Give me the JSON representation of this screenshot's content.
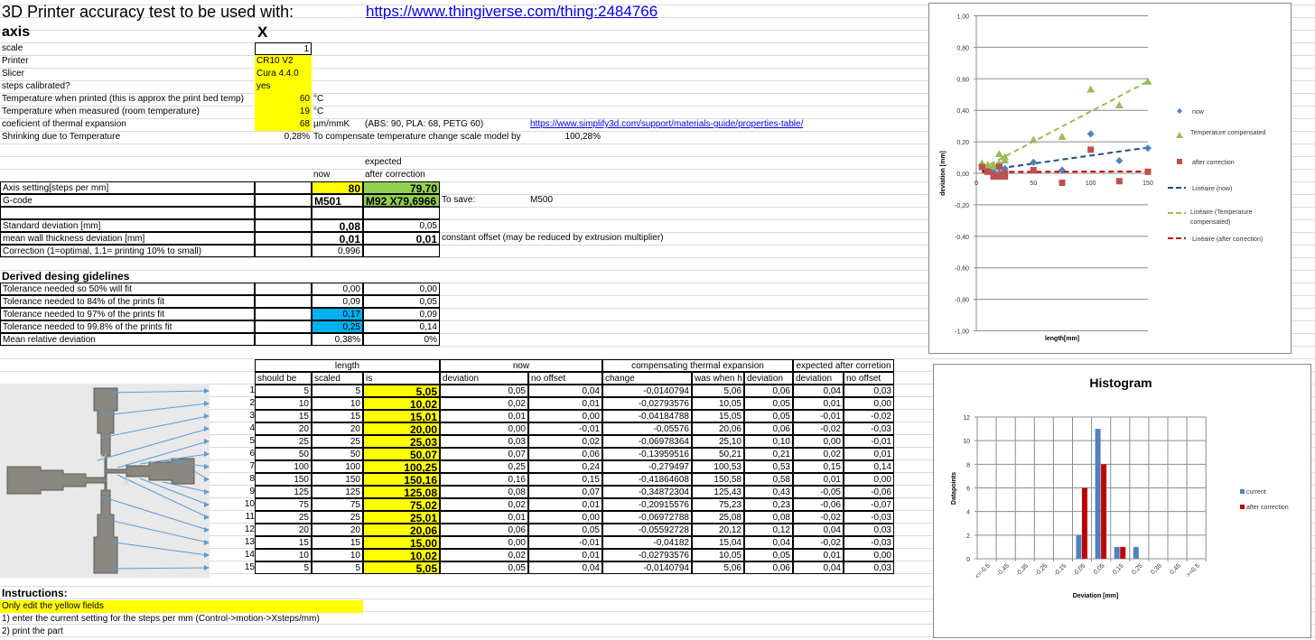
{
  "title": "3D Printer accuracy test to be used with:",
  "link": "https://www.thingiverse.com/thing:2484766",
  "axis": {
    "label": "axis",
    "value": "X"
  },
  "params": [
    {
      "label": "scale",
      "value": "1",
      "unit": ""
    },
    {
      "label": "Printer",
      "value": "CR10 V2",
      "unit": ""
    },
    {
      "label": "Slicer",
      "value": "Cura 4.4.0",
      "unit": ""
    },
    {
      "label": "steps calibrated?",
      "value": "yes",
      "unit": ""
    },
    {
      "label": "Temperature when printed (this is approx the print bed temp)",
      "value": "60",
      "unit": "°C"
    },
    {
      "label": "Temperature when measured (room temperature)",
      "value": "19",
      "unit": "°C"
    },
    {
      "label": "coeficient of thermal expansion",
      "value": "68",
      "unit": "µm/mmK"
    },
    {
      "label": "Shrinking due to Temperature",
      "value": "0,28%",
      "unit": ""
    }
  ],
  "thermal_note": "(ABS: 90, PLA: 68, PETG 60)",
  "thermal_link": "https://www.simplify3d.com/support/materials-guide/properties-table/",
  "compensate_label": "To compensate temperature change scale model by",
  "compensate_value": "100,28%",
  "headers": {
    "expected": "expected",
    "now": "now",
    "after": "after correction"
  },
  "axis_setting": {
    "label": "Axis setting[steps per mm]",
    "now": "80",
    "after": "79,70"
  },
  "gcode": {
    "label": "G-code",
    "now": "M501",
    "after": "M92 X79,6966",
    "save_label": "To save:",
    "save_value": "M500"
  },
  "std": {
    "label": "Standard deviation [mm]",
    "now": "0,08",
    "after": "0,05"
  },
  "mean_wall": {
    "label": "mean wall thickness deviation [mm]",
    "now": "0,01",
    "after": "0,01",
    "note": "constant offset (may be reduced by extrusion multiplier)"
  },
  "correction": {
    "label": "Correction (1=optimal, 1.1= printing 10% to small)",
    "now": "0,996"
  },
  "guidelines": {
    "title": "Derived desing gidelines",
    "rows": [
      {
        "label": "Tolerance needed so 50% will fit",
        "now": "0,00",
        "after": "0,00"
      },
      {
        "label": "Tolerance needed to 84% of the prints fit",
        "now": "0,09",
        "after": "0,05"
      },
      {
        "label": "Tolerance needed to 97% of the prints fit",
        "now": "0,17",
        "after": "0,09"
      },
      {
        "label": "Tolerance needed to 99.8% of the prints fit",
        "now": "0,25",
        "after": "0,14"
      },
      {
        "label": "Mean relative deviation",
        "now": "0,38%",
        "after": "0%"
      }
    ]
  },
  "table": {
    "groups": {
      "length": "length",
      "now": "now",
      "comp": "compensating thermal expansion",
      "expected": "expected after corretion"
    },
    "columns": [
      "should be",
      "scaled",
      "is",
      "deviation",
      "no offset",
      "change",
      "was when h",
      "deviation",
      "deviation",
      "no offset"
    ],
    "rows": [
      [
        "1",
        "5",
        "5",
        "5,05",
        "0,05",
        "0,04",
        "-0,0140794",
        "5,06",
        "0,06",
        "0,04",
        "0,03"
      ],
      [
        "2",
        "10",
        "10",
        "10,02",
        "0,02",
        "0,01",
        "-0,02793576",
        "10,05",
        "0,05",
        "0,01",
        "0,00"
      ],
      [
        "3",
        "15",
        "15",
        "15,01",
        "0,01",
        "0,00",
        "-0,04184788",
        "15,05",
        "0,05",
        "-0,01",
        "-0,02"
      ],
      [
        "4",
        "20",
        "20",
        "20,00",
        "0,00",
        "-0,01",
        "-0,05576",
        "20,06",
        "0,06",
        "-0,02",
        "-0,03"
      ],
      [
        "5",
        "25",
        "25",
        "25,03",
        "0,03",
        "0,02",
        "-0,06978364",
        "25,10",
        "0,10",
        "0,00",
        "-0,01"
      ],
      [
        "6",
        "50",
        "50",
        "50,07",
        "0,07",
        "0,06",
        "-0,13959516",
        "50,21",
        "0,21",
        "0,02",
        "0,01"
      ],
      [
        "7",
        "100",
        "100",
        "100,25",
        "0,25",
        "0,24",
        "-0,279497",
        "100,53",
        "0,53",
        "0,15",
        "0,14"
      ],
      [
        "8",
        "150",
        "150",
        "150,16",
        "0,16",
        "0,15",
        "-0,41864608",
        "150,58",
        "0,58",
        "0,01",
        "0,00"
      ],
      [
        "9",
        "125",
        "125",
        "125,08",
        "0,08",
        "0,07",
        "-0,34872304",
        "125,43",
        "0,43",
        "-0,05",
        "-0,06"
      ],
      [
        "10",
        "75",
        "75",
        "75,02",
        "0,02",
        "0,01",
        "-0,20915576",
        "75,23",
        "0,23",
        "-0,06",
        "-0,07"
      ],
      [
        "11",
        "25",
        "25",
        "25,01",
        "0,01",
        "0,00",
        "-0,06972788",
        "25,08",
        "0,08",
        "-0,02",
        "-0,03"
      ],
      [
        "12",
        "20",
        "20",
        "20,06",
        "0,06",
        "0,05",
        "-0,05592728",
        "20,12",
        "0,12",
        "0,04",
        "0,03"
      ],
      [
        "13",
        "15",
        "15",
        "15,00",
        "0,00",
        "-0,01",
        "-0,04182",
        "15,04",
        "0,04",
        "-0,02",
        "-0,03"
      ],
      [
        "14",
        "10",
        "10",
        "10,02",
        "0,02",
        "0,01",
        "-0,02793576",
        "10,05",
        "0,05",
        "0,01",
        "0,00"
      ],
      [
        "15",
        "5",
        "5",
        "5,05",
        "0,05",
        "0,04",
        "-0,0140794",
        "5,06",
        "0,06",
        "0,04",
        "0,03"
      ]
    ]
  },
  "instructions": {
    "title": "Instructions:",
    "items": [
      "Only edit the yellow fields",
      "1) enter the current setting for the steps per mm (Control->motion->Xsteps/mm)",
      "2) print the  part"
    ]
  },
  "colors": {
    "yellow": "#ffff00",
    "green": "#92d050",
    "blue": "#00b0f0",
    "link": "#0000ee"
  },
  "chart_data": [
    {
      "type": "scatter",
      "xlabel": "length[mm]",
      "ylabel": "deviation  [mm]",
      "xlim": [
        0,
        150
      ],
      "ylim": [
        -1,
        1
      ],
      "xticks": [
        "0",
        "50",
        "100",
        "150"
      ],
      "yticks": [
        "1,00",
        "0,80",
        "0,60",
        "0,40",
        "0,20",
        "0,00",
        "-0,20",
        "-0,40",
        "-0,60",
        "-0,80",
        "-1,00"
      ],
      "grid": true,
      "legend": "right",
      "x": [
        5,
        10,
        15,
        20,
        25,
        50,
        100,
        150,
        125,
        75,
        25,
        20,
        15,
        10,
        5
      ],
      "series": [
        {
          "name": "now",
          "marker": "diamond",
          "color": "#4f81bd",
          "values": [
            0.05,
            0.02,
            0.01,
            0.0,
            0.03,
            0.07,
            0.25,
            0.16,
            0.08,
            0.02,
            0.01,
            0.06,
            0.0,
            0.02,
            0.05
          ]
        },
        {
          "name": "Temperature compensated",
          "marker": "triangle",
          "color": "#9bbb59",
          "values": [
            0.06,
            0.05,
            0.05,
            0.06,
            0.1,
            0.21,
            0.53,
            0.58,
            0.43,
            0.23,
            0.08,
            0.12,
            0.04,
            0.05,
            0.06
          ]
        },
        {
          "name": "after correction",
          "marker": "square",
          "color": "#c0504d",
          "values": [
            0.04,
            0.01,
            -0.01,
            -0.02,
            0.0,
            0.02,
            0.15,
            0.01,
            -0.05,
            -0.06,
            -0.02,
            0.04,
            -0.02,
            0.01,
            0.04
          ]
        }
      ],
      "trendlines": [
        {
          "name": "Linéaire (now)",
          "color": "#1f4e79"
        },
        {
          "name": "Linéaire (Temperature compensated)",
          "color": "#9bbb59"
        },
        {
          "name": "Linéaire (after correction)",
          "color": "#c00000"
        }
      ]
    },
    {
      "type": "bar",
      "title": "Histogram",
      "xlabel": "Deviation  [mm]",
      "ylabel": "Datapoints",
      "ylim": [
        0,
        12
      ],
      "yticks": [
        "0",
        "2",
        "4",
        "6",
        "8",
        "10",
        "12"
      ],
      "grid": true,
      "legend": "right",
      "categories": [
        "<=-0.5",
        "-0,45",
        "-0,35",
        "-0,25",
        "-0,15",
        "-0,05",
        "0,05",
        "0,15",
        "0,25",
        "0,35",
        "0,45",
        ">=0.5"
      ],
      "series": [
        {
          "name": "current",
          "color": "#4f81bd",
          "values": [
            0,
            0,
            0,
            0,
            0,
            2,
            11,
            1,
            1,
            0,
            0,
            0
          ]
        },
        {
          "name": "after correction",
          "color": "#c00000",
          "values": [
            0,
            0,
            0,
            0,
            0,
            6,
            8,
            1,
            0,
            0,
            0,
            0
          ]
        }
      ]
    }
  ]
}
